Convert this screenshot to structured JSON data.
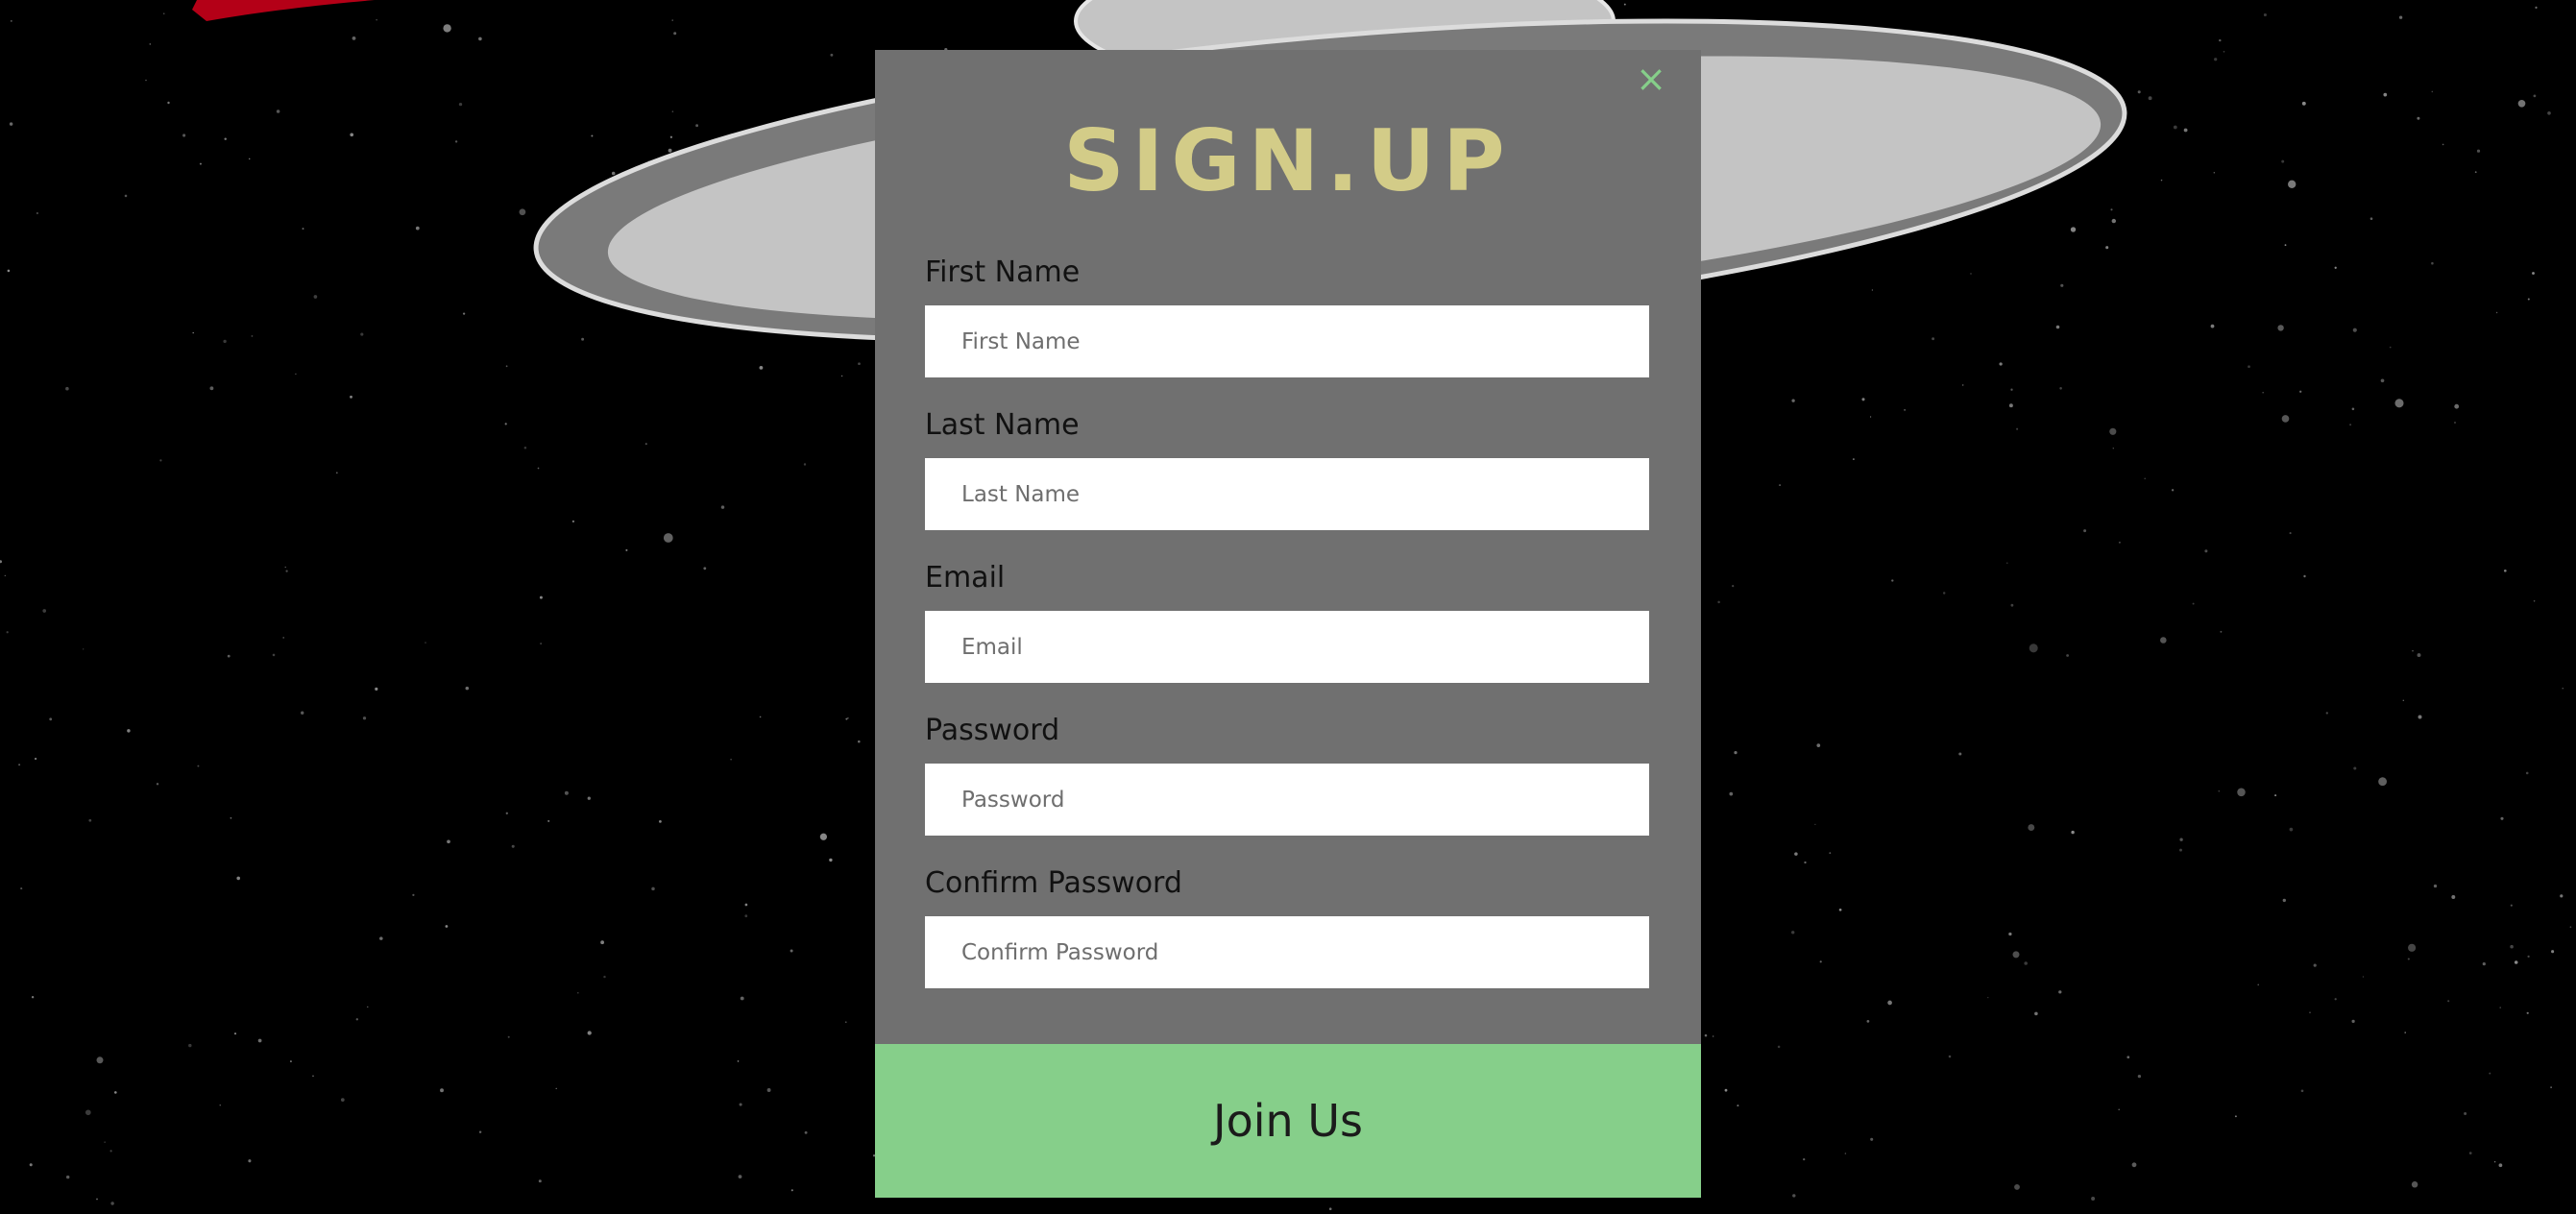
{
  "colors": {
    "background": "#000000",
    "modal_background": "#707070",
    "title_color": "#d3cc88",
    "accent_green": "#86cf8a",
    "saucer_light": "#c4c4c4",
    "saucer_dark": "#7a7a7a",
    "decoration_red": "#c8001a"
  },
  "signup": {
    "close_icon": "close-icon",
    "close_glyph": "×",
    "title": "SIGN.UP",
    "fields": [
      {
        "label": "First Name",
        "placeholder": "First Name",
        "value": ""
      },
      {
        "label": "Last Name",
        "placeholder": "Last Name",
        "value": ""
      },
      {
        "label": "Email",
        "placeholder": "Email",
        "value": ""
      },
      {
        "label": "Password",
        "placeholder": "Password",
        "value": ""
      },
      {
        "label": "Confirm Password",
        "placeholder": "Confirm Password",
        "value": ""
      }
    ],
    "submit_label": "Join Us"
  }
}
